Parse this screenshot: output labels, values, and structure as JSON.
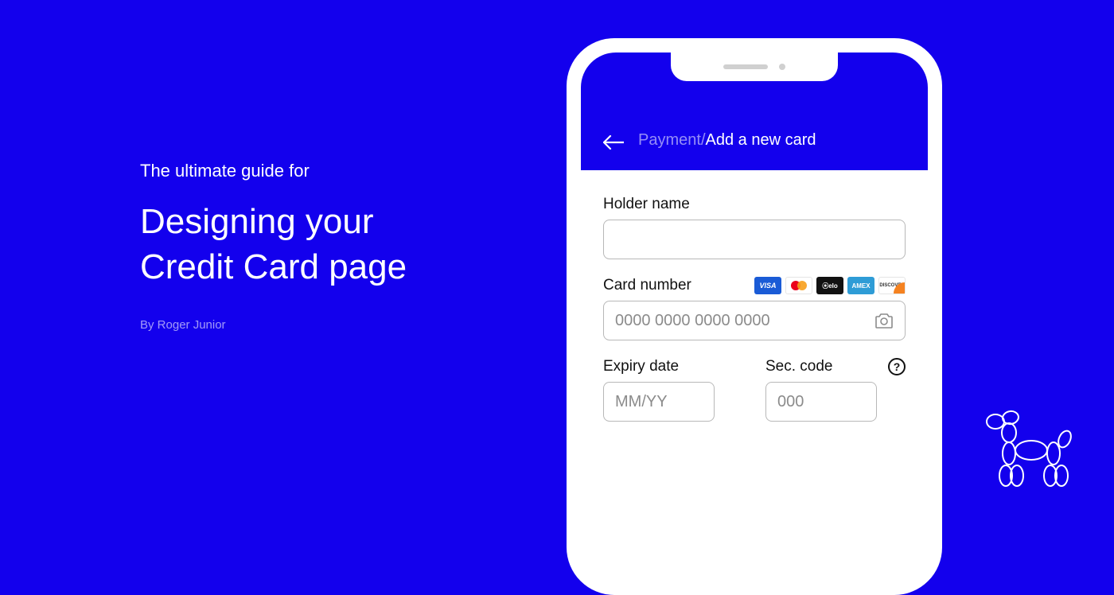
{
  "hero": {
    "eyebrow": "The ultimate guide for",
    "title_line1": "Designing your",
    "title_line2": "Credit Card page",
    "byline": "By Roger Junior"
  },
  "breadcrumb": {
    "parent": "Payment",
    "separator": "/",
    "current": "Add a new card"
  },
  "form": {
    "holder_label": "Holder name",
    "card_number_label": "Card number",
    "card_number_placeholder": "0000 0000 0000 0000",
    "expiry_label": "Expiry date",
    "expiry_placeholder": "MM/YY",
    "sec_label": "Sec. code",
    "sec_placeholder": "000"
  },
  "card_brands": {
    "visa": "VISA",
    "elo": "elo",
    "amex": "AMEX",
    "discover": "DISCOVER"
  }
}
